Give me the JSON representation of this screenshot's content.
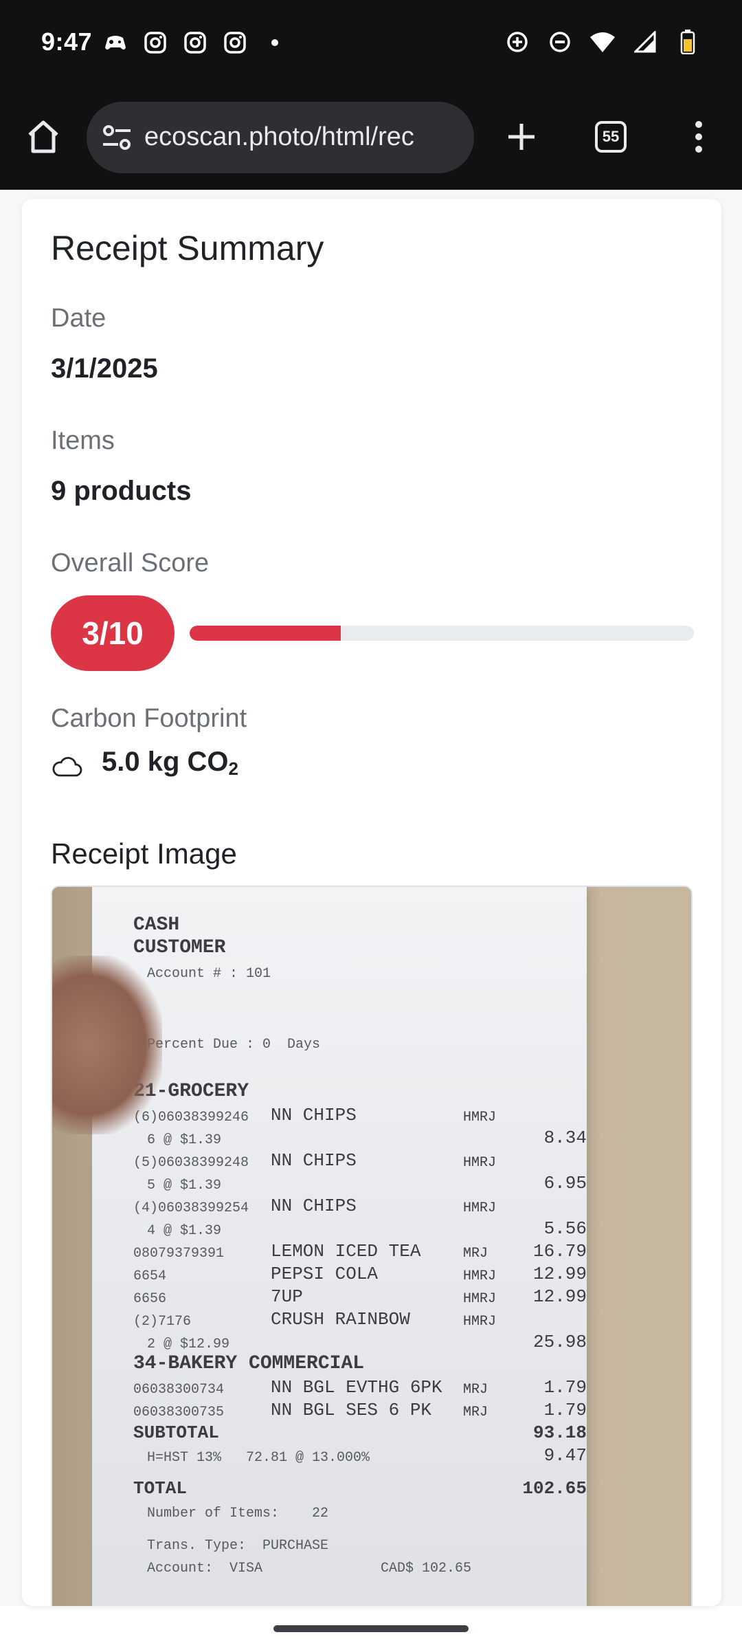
{
  "status_bar": {
    "time": "9:47",
    "left_icons": [
      "game-controller-icon",
      "instagram-icon",
      "instagram-icon",
      "instagram-icon",
      "dot-icon"
    ],
    "right_icons": [
      "data-saver-icon",
      "do-not-disturb-icon",
      "wifi-icon",
      "signal-icon",
      "battery-icon"
    ]
  },
  "browser": {
    "url": "ecoscan.photo/html/rec",
    "tab_count": "55"
  },
  "card": {
    "title": "Receipt Summary",
    "date_label": "Date",
    "date_value": "3/1/2025",
    "items_label": "Items",
    "items_value": "9 products",
    "score_label": "Overall Score",
    "score_value": "3/10",
    "score_fraction": 0.3,
    "carbon_label": "Carbon Footprint",
    "carbon_value": "5.0 kg CO",
    "carbon_sub": "2",
    "receipt_heading": "Receipt Image"
  },
  "receipt": {
    "header": [
      "CASH",
      "CUSTOMER",
      "Account # : 101"
    ],
    "percent_due": "Percent Due : 0  Days",
    "dept1": "21-GROCERY",
    "lines": [
      {
        "code": "(6)06038399246",
        "desc": "NN CHIPS",
        "flag": "HMRJ",
        "amt": ""
      },
      {
        "sub": "6 @ $1.39",
        "amt": "8.34"
      },
      {
        "code": "(5)06038399248",
        "desc": "NN CHIPS",
        "flag": "HMRJ",
        "amt": ""
      },
      {
        "sub": "5 @ $1.39",
        "amt": "6.95"
      },
      {
        "code": "(4)06038399254",
        "desc": "NN CHIPS",
        "flag": "HMRJ",
        "amt": ""
      },
      {
        "sub": "4 @ $1.39",
        "amt": "5.56"
      },
      {
        "code": "08079379391",
        "desc": "LEMON ICED TEA",
        "flag": "MRJ",
        "amt": "16.79"
      },
      {
        "code": "6654",
        "desc": "PEPSI COLA",
        "flag": "HMRJ",
        "amt": "12.99"
      },
      {
        "code": "6656",
        "desc": "7UP",
        "flag": "HMRJ",
        "amt": "12.99"
      },
      {
        "code": "(2)7176",
        "desc": "CRUSH RAINBOW",
        "flag": "HMRJ",
        "amt": ""
      },
      {
        "sub": "2 @ $12.99",
        "amt": "25.98"
      }
    ],
    "dept2": "34-BAKERY COMMERCIAL",
    "lines2": [
      {
        "code": "06038300734",
        "desc": "NN BGL EVTHG 6PK",
        "flag": "MRJ",
        "amt": "1.79"
      },
      {
        "code": "06038300735",
        "desc": "NN BGL SES 6 PK",
        "flag": "MRJ",
        "amt": "1.79"
      }
    ],
    "subtotal_label": "SUBTOTAL",
    "subtotal": "93.18",
    "tax_line": "H=HST 13%   72.81 @ 13.000%",
    "tax": "9.47",
    "total_label": "TOTAL",
    "total": "102.65",
    "num_items": "Number of Items:    22",
    "trans_type": "Trans. Type:  PURCHASE",
    "account": "Account:  VISA",
    "cad": "CAD$ 102.65"
  }
}
